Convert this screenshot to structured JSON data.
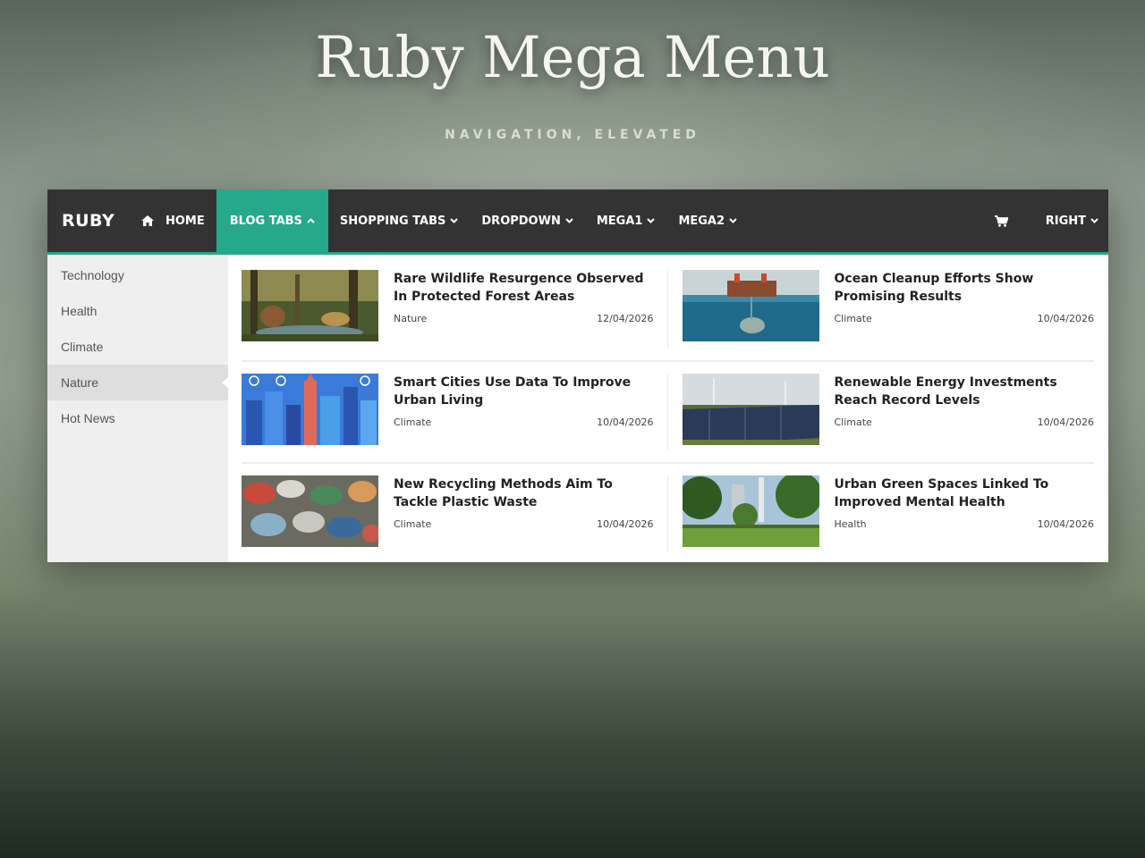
{
  "hero": {
    "title": "Ruby Mega Menu",
    "subtitle": "NAVIGATION, ELEVATED"
  },
  "navbar": {
    "brand": "RUBY",
    "home_label": "HOME",
    "home_icon": "home-icon",
    "items": [
      {
        "label": "BLOG TABS",
        "icon": "chevron-up-icon"
      },
      {
        "label": "SHOPPING TABS",
        "icon": "chevron-down-icon"
      },
      {
        "label": "DROPDOWN",
        "icon": "chevron-down-icon"
      },
      {
        "label": "MEGA1",
        "icon": "chevron-down-icon"
      },
      {
        "label": "MEGA2",
        "icon": "chevron-down-icon"
      }
    ],
    "cart_icon": "cart-icon",
    "right_label": "RIGHT",
    "accent_color": "#25a98a",
    "bar_color": "#333333"
  },
  "sidebar": {
    "items": [
      {
        "label": "Technology"
      },
      {
        "label": "Health"
      },
      {
        "label": "Climate"
      },
      {
        "label": "Nature",
        "active": true
      },
      {
        "label": "Hot News"
      }
    ]
  },
  "posts": [
    {
      "title": "Rare Wildlife Resurgence Observed In Protected Forest Areas",
      "category": "Nature",
      "date": "12/04/2026",
      "thumb": "forest-wildlife-image"
    },
    {
      "title": "Ocean Cleanup Efforts Show Promising Results",
      "category": "Climate",
      "date": "10/04/2026",
      "thumb": "ocean-cleanup-image"
    },
    {
      "title": "Smart Cities Use Data To Improve Urban Living",
      "category": "Climate",
      "date": "10/04/2026",
      "thumb": "smart-city-image"
    },
    {
      "title": "Renewable Energy Investments Reach Record Levels",
      "category": "Climate",
      "date": "10/04/2026",
      "thumb": "solar-wind-image"
    },
    {
      "title": "New Recycling Methods Aim To Tackle Plastic Waste",
      "category": "Climate",
      "date": "10/04/2026",
      "thumb": "plastic-bottles-image"
    },
    {
      "title": "Urban Green Spaces Linked To Improved Mental Health",
      "category": "Health",
      "date": "10/04/2026",
      "thumb": "city-park-image"
    }
  ]
}
